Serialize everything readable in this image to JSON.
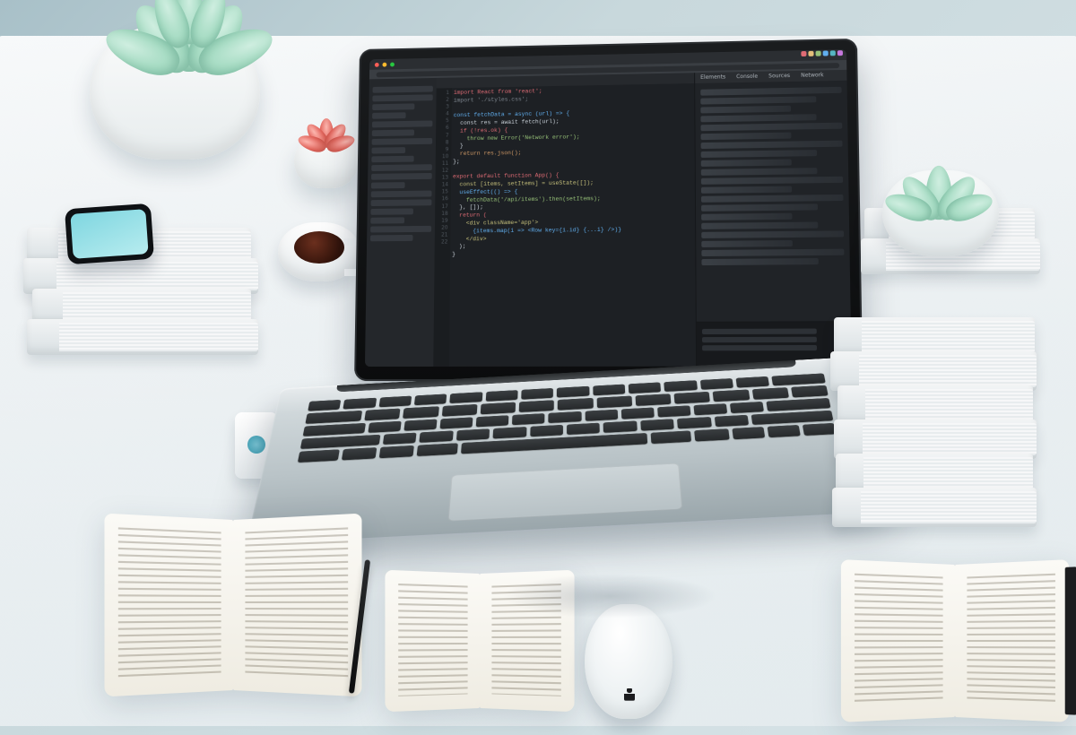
{
  "description": "Stylized 3D render / photo of a tidy white desk viewed from above at an angle. A silver MacBook-style laptop sits center with a dark code-editor and browser devtools on screen. Around it: succulent plants in white pots, a small red succulent, a white coffee cup, stacks of grey hardcover books, a smartphone lying on the left stack, an eraser/USB stick, a pen, two small open books and a notebook in front, an Apple-style white mouse, and another book stack with a succulent on the right.",
  "laptop_screen": {
    "browser_dots": [
      "#ff5f57",
      "#febc2e",
      "#28c840"
    ],
    "devtools_tabs": [
      "Elements",
      "Console",
      "Sources",
      "Network"
    ],
    "toolbar_swatches": [
      "#e06c75",
      "#e5c07b",
      "#98c379",
      "#61afef",
      "#56b6c2",
      "#c678dd"
    ],
    "line_count": 22,
    "code_lines": [
      {
        "t": "import React from 'react';",
        "cls": "k"
      },
      {
        "t": "import './styles.css';",
        "cls": "m"
      },
      {
        "t": "",
        "cls": ""
      },
      {
        "t": "const fetchData = async (url) => {",
        "cls": "f"
      },
      {
        "t": "  const res = await fetch(url);",
        "cls": ""
      },
      {
        "t": "  if (!res.ok) {",
        "cls": "k"
      },
      {
        "t": "    throw new Error('Network error');",
        "cls": "s"
      },
      {
        "t": "  }",
        "cls": ""
      },
      {
        "t": "  return res.json();",
        "cls": "p"
      },
      {
        "t": "};",
        "cls": ""
      },
      {
        "t": "",
        "cls": ""
      },
      {
        "t": "export default function App() {",
        "cls": "k"
      },
      {
        "t": "  const [items, setItems] = useState([]);",
        "cls": "c"
      },
      {
        "t": "  useEffect(() => {",
        "cls": "f"
      },
      {
        "t": "    fetchData('/api/items').then(setItems);",
        "cls": "s"
      },
      {
        "t": "  }, []);",
        "cls": ""
      },
      {
        "t": "  return (",
        "cls": "k"
      },
      {
        "t": "    <div className='app'>",
        "cls": "c"
      },
      {
        "t": "      {items.map(i => <Row key={i.id} {...i} />)}",
        "cls": "f"
      },
      {
        "t": "    </div>",
        "cls": "c"
      },
      {
        "t": "  );",
        "cls": ""
      },
      {
        "t": "}",
        "cls": ""
      }
    ]
  }
}
